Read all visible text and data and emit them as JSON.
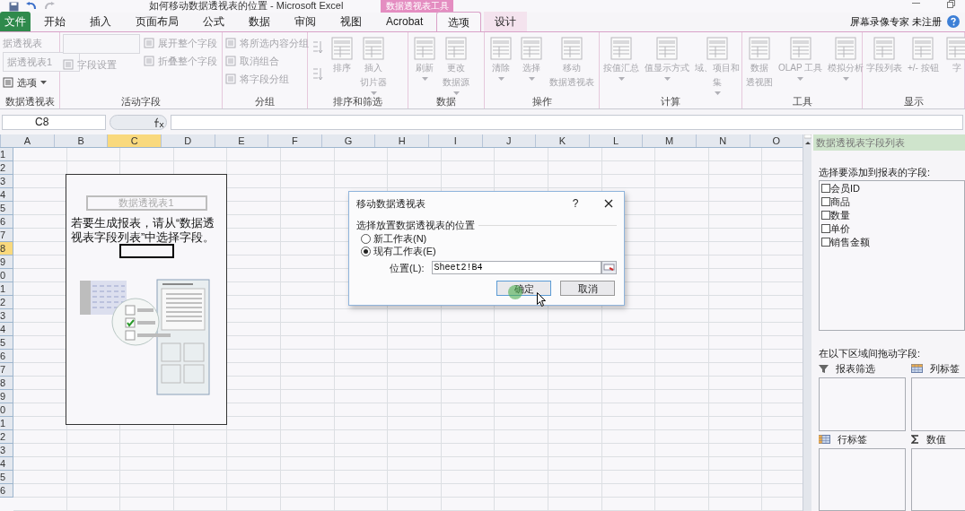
{
  "title_bar": {
    "title": "如何移动数据透视表的位置 - Microsoft Excel",
    "context_group": "数据透视表工具",
    "user_text": "屏幕录像专家 未注册"
  },
  "ribbon_tabs": [
    {
      "label": "文件",
      "kind": "file",
      "selected": false
    },
    {
      "label": "开始",
      "kind": "tab",
      "selected": false
    },
    {
      "label": "插入",
      "kind": "tab",
      "selected": false
    },
    {
      "label": "页面布局",
      "kind": "tab",
      "selected": false
    },
    {
      "label": "公式",
      "kind": "tab",
      "selected": false
    },
    {
      "label": "数据",
      "kind": "tab",
      "selected": false
    },
    {
      "label": "审阅",
      "kind": "tab",
      "selected": false
    },
    {
      "label": "视图",
      "kind": "tab",
      "selected": false
    },
    {
      "label": "Acrobat",
      "kind": "tab",
      "selected": false
    },
    {
      "label": "选项",
      "kind": "context",
      "selected": true
    },
    {
      "label": "设计",
      "kind": "context",
      "selected": false
    }
  ],
  "ribbon_groups": [
    {
      "label": "数据透视表",
      "commands": [
        {
          "kind": "label",
          "lines": [
            "据透视表"
          ],
          "disabled": true
        },
        {
          "kind": "field",
          "lines": [
            "据透视表1"
          ],
          "disabled": true
        },
        {
          "kind": "menu",
          "lines": [
            "选项"
          ],
          "disabled": false
        }
      ]
    },
    {
      "label": "活动字段",
      "commands": [
        {
          "kind": "field",
          "disabled": true
        },
        {
          "kind": "small",
          "lines": [
            "字段设置"
          ],
          "disabled": true
        },
        {
          "kind": "small",
          "lines": [
            "展开整个字段"
          ],
          "disabled": true
        },
        {
          "kind": "small",
          "lines": [
            "折叠整个字段"
          ],
          "disabled": true
        }
      ]
    },
    {
      "label": "分组",
      "commands": [
        {
          "kind": "small",
          "lines": [
            "将所选内容分组"
          ],
          "disabled": true
        },
        {
          "kind": "small",
          "lines": [
            "取消组合"
          ],
          "disabled": true
        },
        {
          "kind": "small",
          "lines": [
            "将字段分组"
          ],
          "disabled": true
        }
      ]
    },
    {
      "label": "排序和筛选",
      "commands": [
        {
          "kind": "sort",
          "disabled": true
        },
        {
          "kind": "sort",
          "disabled": true
        },
        {
          "kind": "large",
          "lines": [
            "排序"
          ],
          "dropdown": false,
          "disabled": true
        },
        {
          "kind": "large",
          "lines": [
            "插入",
            "切片器"
          ],
          "dropdown": true,
          "disabled": true
        }
      ]
    },
    {
      "label": "数据",
      "commands": [
        {
          "kind": "large",
          "lines": [
            "刷新"
          ],
          "dropdown": true,
          "disabled": true
        },
        {
          "kind": "large",
          "lines": [
            "更改",
            "数据源"
          ],
          "dropdown": true,
          "disabled": true
        }
      ]
    },
    {
      "label": "操作",
      "commands": [
        {
          "kind": "large",
          "lines": [
            "清除"
          ],
          "dropdown": true,
          "disabled": true
        },
        {
          "kind": "large",
          "lines": [
            "选择"
          ],
          "dropdown": true,
          "disabled": true
        },
        {
          "kind": "large",
          "lines": [
            "移动",
            "数据透视表"
          ],
          "dropdown": false,
          "disabled": true
        }
      ]
    },
    {
      "label": "计算",
      "commands": [
        {
          "kind": "large",
          "lines": [
            "按值汇总"
          ],
          "dropdown": true,
          "disabled": true
        },
        {
          "kind": "large",
          "lines": [
            "值显示方式"
          ],
          "dropdown": true,
          "disabled": true
        },
        {
          "kind": "large",
          "lines": [
            "域、项目和",
            "集"
          ],
          "dropdown": true,
          "disabled": true
        }
      ]
    },
    {
      "label": "工具",
      "commands": [
        {
          "kind": "large",
          "lines": [
            "数据",
            "透视图"
          ],
          "dropdown": false,
          "disabled": true
        },
        {
          "kind": "large",
          "lines": [
            "OLAP 工具"
          ],
          "dropdown": true,
          "disabled": true
        },
        {
          "kind": "large",
          "lines": [
            "模拟分析"
          ],
          "dropdown": true,
          "disabled": true
        }
      ]
    },
    {
      "label": "显示",
      "commands": [
        {
          "kind": "large",
          "lines": [
            "字段列表"
          ],
          "dropdown": false,
          "disabled": true
        },
        {
          "kind": "large",
          "lines": [
            "+/- 按钮"
          ],
          "dropdown": false,
          "disabled": true
        },
        {
          "kind": "large",
          "lines": [
            "字"
          ],
          "dropdown": false,
          "disabled": true
        }
      ]
    }
  ],
  "formula_bar": {
    "name_box": "C8"
  },
  "columns": [
    {
      "label": "A",
      "selected": false
    },
    {
      "label": "B",
      "selected": false
    },
    {
      "label": "C",
      "selected": true
    },
    {
      "label": "D",
      "selected": false
    },
    {
      "label": "E",
      "selected": false
    },
    {
      "label": "F",
      "selected": false
    },
    {
      "label": "G",
      "selected": false
    },
    {
      "label": "H",
      "selected": false
    },
    {
      "label": "I",
      "selected": false
    },
    {
      "label": "J",
      "selected": false
    },
    {
      "label": "K",
      "selected": false
    },
    {
      "label": "L",
      "selected": false
    },
    {
      "label": "M",
      "selected": false
    },
    {
      "label": "N",
      "selected": false
    },
    {
      "label": "O",
      "selected": false
    }
  ],
  "rows": [
    {
      "label": "1",
      "selected": false
    },
    {
      "label": "2",
      "selected": false
    },
    {
      "label": "3",
      "selected": false
    },
    {
      "label": "4",
      "selected": false
    },
    {
      "label": "5",
      "selected": false
    },
    {
      "label": "6",
      "selected": false
    },
    {
      "label": "7",
      "selected": false
    },
    {
      "label": "8",
      "selected": true
    },
    {
      "label": "9",
      "selected": false
    },
    {
      "label": "0",
      "selected": false
    },
    {
      "label": "1",
      "selected": false
    },
    {
      "label": "2",
      "selected": false
    },
    {
      "label": "3",
      "selected": false
    },
    {
      "label": "4",
      "selected": false
    },
    {
      "label": "5",
      "selected": false
    },
    {
      "label": "6",
      "selected": false
    },
    {
      "label": "7",
      "selected": false
    },
    {
      "label": "8",
      "selected": false
    },
    {
      "label": "9",
      "selected": false
    },
    {
      "label": "0",
      "selected": false
    },
    {
      "label": "1",
      "selected": false
    },
    {
      "label": "2",
      "selected": false
    },
    {
      "label": "3",
      "selected": false
    },
    {
      "label": "4",
      "selected": false
    },
    {
      "label": "5",
      "selected": false
    },
    {
      "label": "6",
      "selected": false
    }
  ],
  "pivot_placeholder": {
    "title": "数据透视表1",
    "message": "若要生成报表，请从“数据透视表字段列表”中选择字段。"
  },
  "dialog": {
    "title": "移动数据透视表",
    "help": "?",
    "section": "选择放置数据透视表的位置",
    "options": [
      {
        "label": "新工作表(N)",
        "selected": false
      },
      {
        "label": "现有工作表(E)",
        "selected": true
      }
    ],
    "location_label": "位置(L):",
    "location_value": "Sheet2!B4",
    "buttons": [
      "确定",
      "取消"
    ]
  },
  "field_list": {
    "title": "数据透视表字段列表",
    "choose_label": "选择要添加到报表的字段:",
    "fields": [
      {
        "label": "会员ID",
        "checked": false
      },
      {
        "label": "商品",
        "checked": false
      },
      {
        "label": "数量",
        "checked": false
      },
      {
        "label": "单价",
        "checked": false
      },
      {
        "label": "销售金额",
        "checked": false
      }
    ],
    "drag_label": "在以下区域间拖动字段:",
    "areas": [
      {
        "label": "报表筛选",
        "kind": "filter"
      },
      {
        "label": "列标签",
        "kind": "columns"
      },
      {
        "label": "行标签",
        "kind": "rows"
      },
      {
        "label": "数值",
        "kind": "values"
      }
    ]
  }
}
